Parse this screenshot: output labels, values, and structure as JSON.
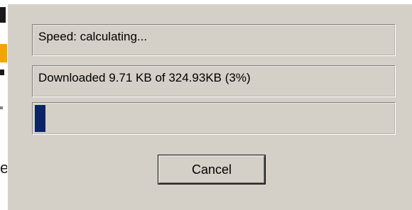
{
  "dialog": {
    "speed_text": "Speed: calculating...",
    "downloaded_text": "Downloaded 9.71 KB of 324.93KB (3%)",
    "progress_percent": 3,
    "cancel_label": "Cancel"
  },
  "background": {
    "partial_glyph": "e"
  },
  "colors": {
    "dialog_face": "#d4d0c8",
    "progress_fill": "#0a246a"
  }
}
